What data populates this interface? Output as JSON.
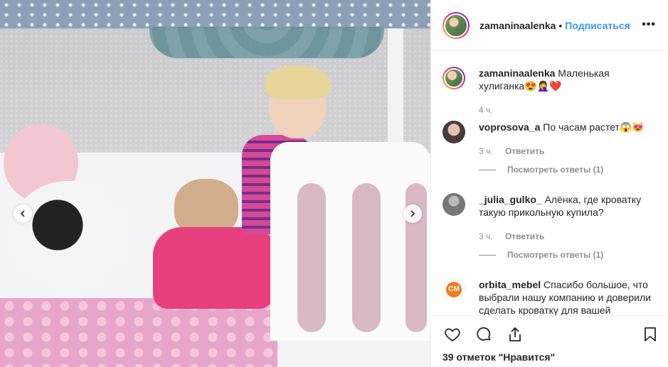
{
  "post": {
    "owner": "zamaninaalenka",
    "follow_label": "Подписаться",
    "dot": "•",
    "more": "•••",
    "caption": {
      "username": "zamaninaalenka",
      "text": "Маленькая хулиганка😍🤦‍♀️❤️",
      "time": "4 ч."
    }
  },
  "comments": [
    {
      "username": "voprosova_a",
      "text": "По часам растет😱😻",
      "time": "3 ч.",
      "reply_label": "Ответить",
      "view_replies": "Посмотреть ответы (1)"
    },
    {
      "username": "_julia_gulko_",
      "text": "Алёнка, где кроватку такую прикольную купила?",
      "time": "3 ч.",
      "reply_label": "Ответить",
      "view_replies": "Посмотреть ответы (1)"
    },
    {
      "username": "orbita_mebel",
      "text": "Спасибо большое, что выбрали нашу компанию и доверили сделать кроватку для вашей",
      "avatar_letters": "CM"
    }
  ],
  "likes_text": "39 отметок \"Нравится\"",
  "icons": {
    "like": "heart-icon",
    "comment": "comment-icon",
    "share": "share-icon",
    "save": "bookmark-icon",
    "prev": "chevron-left-icon",
    "next": "chevron-right-icon"
  },
  "colors": {
    "accent": "#3897f0",
    "muted": "#8e8e8e",
    "text": "#262626"
  }
}
